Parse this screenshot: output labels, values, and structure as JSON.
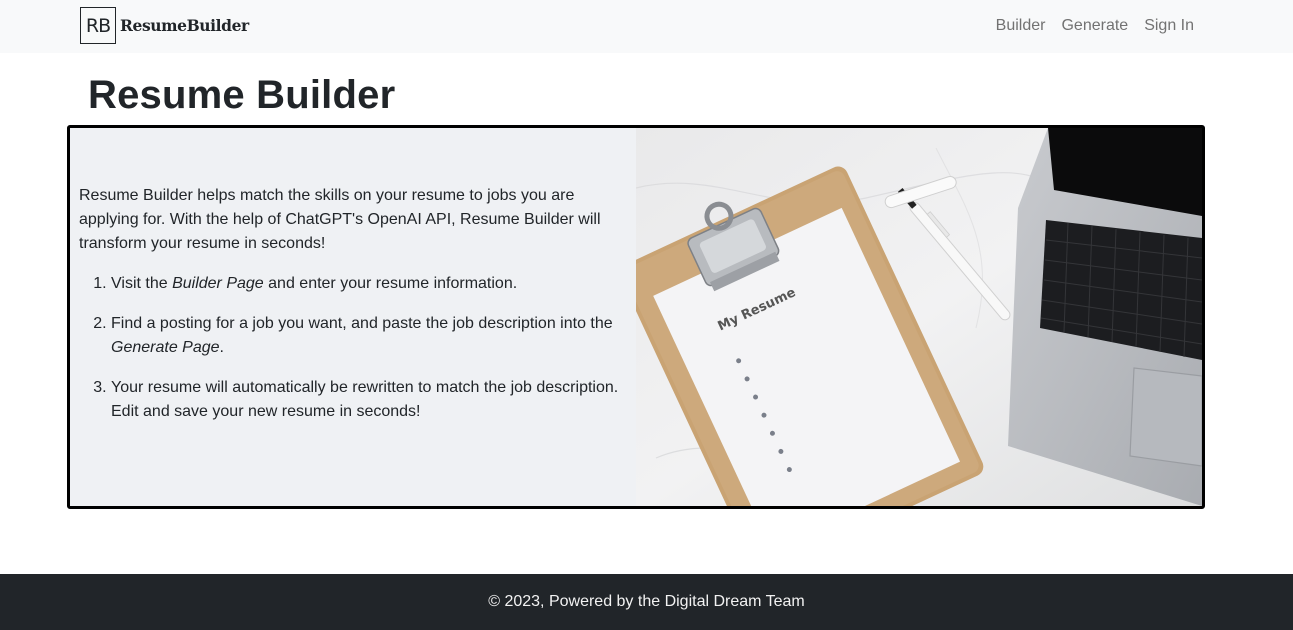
{
  "navbar": {
    "brand_mark": "RB",
    "brand_name": "ResumeBuilder",
    "links": [
      {
        "label": "Builder"
      },
      {
        "label": "Generate"
      },
      {
        "label": "Sign In"
      }
    ]
  },
  "main": {
    "title": "Resume Builder",
    "intro": "Resume Builder helps match the skills on your resume to jobs you are applying for. With the help of ChatGPT's OpenAI API, Resume Builder will transform your resume in seconds!",
    "steps": [
      {
        "before": "Visit the ",
        "em": "Builder Page",
        "after": " and enter your resume information."
      },
      {
        "before": "Find a posting for a job you want, and paste the job description into the ",
        "em": "Generate Page",
        "after": "."
      },
      {
        "before": "Your resume will automatically be rewritten to match the job description. Edit and save your new resume in seconds!",
        "em": "",
        "after": ""
      }
    ],
    "image": {
      "subject": "clipboard-resume-laptop-photo",
      "clipboard_text": "My Resume"
    }
  },
  "footer": {
    "text": "© 2023, Powered by the Digital Dream Team"
  },
  "colors": {
    "navbar_bg": "#f8f9fa",
    "footer_bg": "#212529",
    "card_bg": "#eff1f4",
    "card_border": "#000000",
    "nav_link": "#727272"
  }
}
